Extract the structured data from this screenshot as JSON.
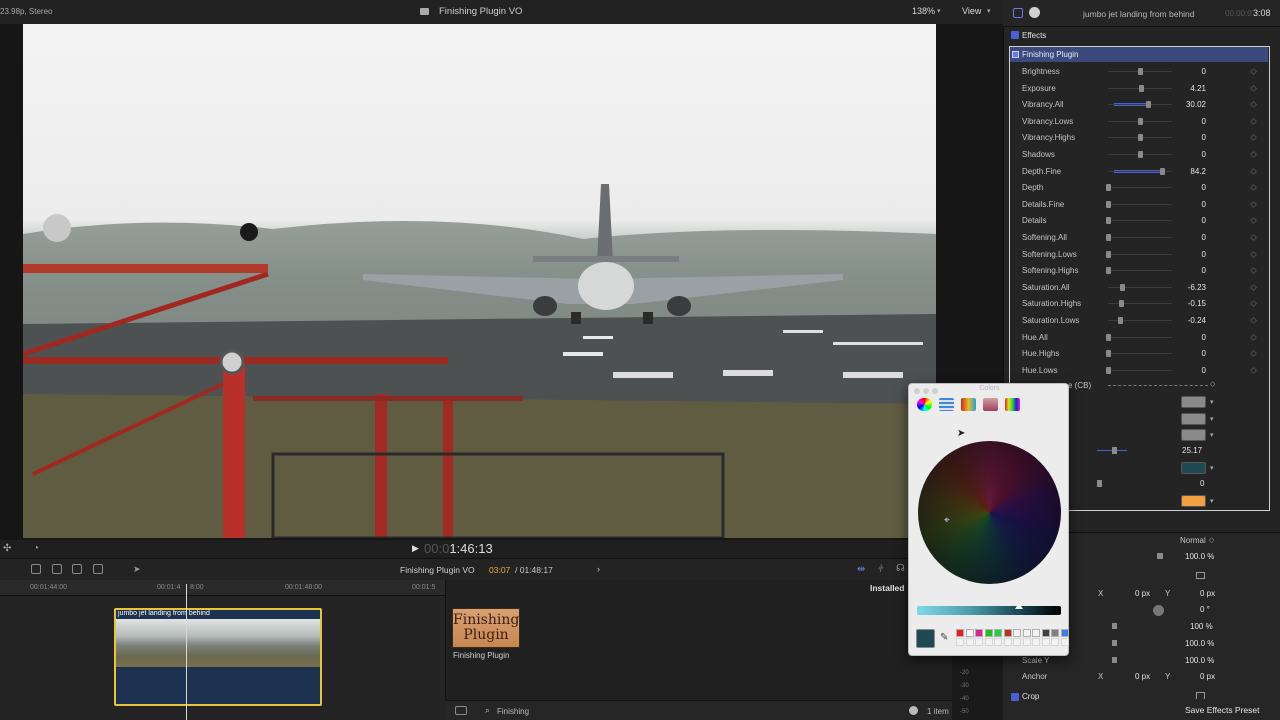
{
  "topbar": {
    "format": "23.98p, Stereo",
    "title": "Finishing Plugin VO",
    "zoom": "138%",
    "view": "View"
  },
  "viewer": {
    "timecode_dim": "00:0",
    "timecode": "1:46:13"
  },
  "timeline": {
    "project": "Finishing Plugin VO",
    "position": "03:07",
    "duration": "/ 01:48:17",
    "ruler": [
      "00:01:44:00",
      "00:01:4",
      "8:00",
      "00:01:48:00",
      "00:01:5"
    ],
    "clip_name": "jumbo jet landing from behind"
  },
  "browser": {
    "installed": "Installed",
    "item_title_line1": "Finishing",
    "item_title_line2": "Plugin",
    "item_name": "Finishing Plugin",
    "search": "Finishing",
    "count": "1 item"
  },
  "inspector": {
    "clip_name": "jumbo jet landing from behind",
    "duration_dim": "00:00:0",
    "duration": "3:08",
    "effects_label": "Effects",
    "plugin_label": "Finishing Plugin",
    "params": [
      {
        "label": "Brightness",
        "value": "0",
        "pos": 0.5
      },
      {
        "label": "Exposure",
        "value": "4.21",
        "pos": 0.52
      },
      {
        "label": "Vibrancy.All",
        "value": "30.02",
        "pos": 0.62
      },
      {
        "label": "Vibrancy.Lows",
        "value": "0",
        "pos": 0.5
      },
      {
        "label": "Vibrancy.Highs",
        "value": "0",
        "pos": 0.5
      },
      {
        "label": "Shadows",
        "value": "0",
        "pos": 0.5
      },
      {
        "label": "Depth.Fine",
        "value": "84.2",
        "pos": 0.84
      },
      {
        "label": "Depth",
        "value": "0",
        "pos": 0.0
      },
      {
        "label": "Details.Fine",
        "value": "0",
        "pos": 0.0
      },
      {
        "label": "Details",
        "value": "0",
        "pos": 0.0
      },
      {
        "label": "Softening.All",
        "value": "0",
        "pos": 0.0
      },
      {
        "label": "Softening.Lows",
        "value": "0",
        "pos": 0.0
      },
      {
        "label": "Softening.Highs",
        "value": "0",
        "pos": 0.0
      },
      {
        "label": "Saturation.All",
        "value": "-6.23",
        "pos": 0.22
      },
      {
        "label": "Saturation.Highs",
        "value": "-0.15",
        "pos": 0.2
      },
      {
        "label": "Saturation.Lows",
        "value": "-0.24",
        "pos": 0.18
      },
      {
        "label": "Hue.All",
        "value": "0",
        "pos": 0.0
      },
      {
        "label": "Hue.Highs",
        "value": "0",
        "pos": 0.0
      },
      {
        "label": "Hue.Lows",
        "value": "0",
        "pos": 0.0
      }
    ],
    "partial_label": "e (CB)",
    "extra_value_1": "25.17",
    "extra_value_2": "0",
    "swatch_colors": [
      "#8a8a8a",
      "#8a8a8a",
      "#8a8a8a",
      "#1f4a53",
      "#f0a040"
    ],
    "lower": {
      "blend_mode": "Normal",
      "opacity": "100.0 %",
      "x_label": "X",
      "pos_x": "0 px",
      "y_label": "Y",
      "pos_y": "0 px",
      "rotation": "0 °",
      "scale_all": "100 %",
      "scale_x": "100.0 %",
      "scale_y_label": "Scale Y",
      "scale_y": "100.0 %",
      "anchor_label": "Anchor",
      "anchor_x": "0 px",
      "anchor_y": "0 px",
      "crop_label": "Crop",
      "save_preset": "Save Effects Preset"
    }
  },
  "picker": {
    "title": "Colors",
    "current_color": "#1f4a53",
    "palette": [
      "#e02020",
      "#ffffff",
      "#e02090",
      "#20c020",
      "#20d040",
      "#c03020",
      "#f2f2f2",
      "#f2f2f2",
      "#f2f2f2",
      "#404040",
      "#808080",
      "#3a80e0"
    ]
  },
  "meter": {
    "ticks": [
      "-20",
      "-30",
      "-40",
      "-50"
    ]
  }
}
